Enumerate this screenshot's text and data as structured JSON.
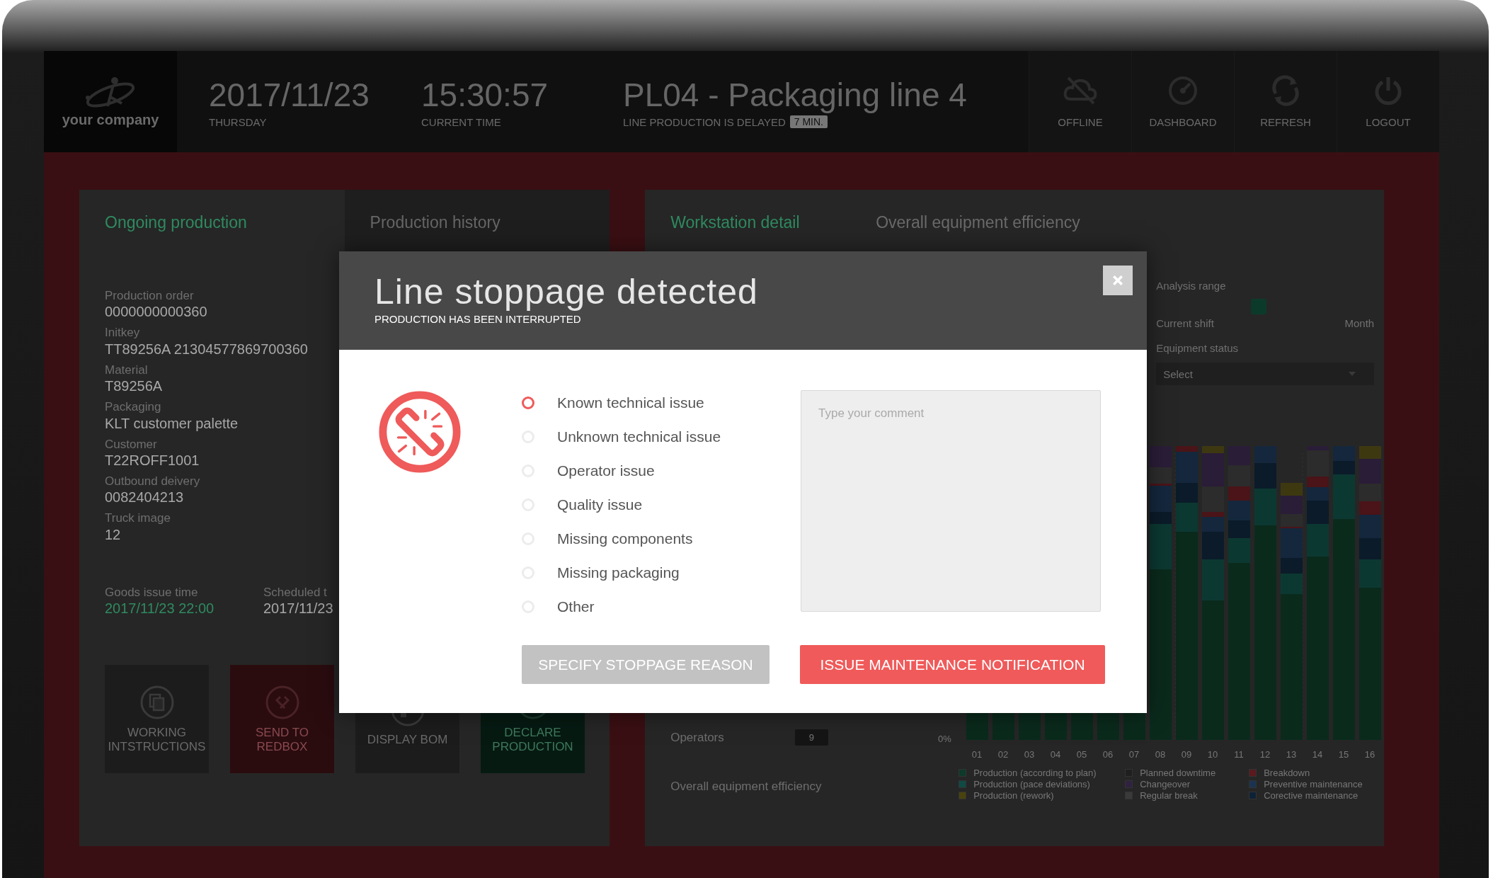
{
  "header": {
    "logo_text": "your company",
    "date": "2017/11/23",
    "weekday": "THURSDAY",
    "time": "15:30:57",
    "time_label": "CURRENT TIME",
    "line_title": "PL04 - Packaging line 4",
    "line_status": "LINE PRODUCTION IS DELAYED",
    "delay_badge": "7 MIN.",
    "actions": [
      {
        "label": "OFFLINE",
        "kind": "offline"
      },
      {
        "label": "DASHBOARD",
        "kind": "dashboard"
      },
      {
        "label": "REFRESH",
        "kind": "refresh"
      },
      {
        "label": "LOGOUT",
        "kind": "logout"
      }
    ]
  },
  "left_panel": {
    "tabs": [
      {
        "label": "Ongoing production",
        "selected": true
      },
      {
        "label": "Production history",
        "selected": false
      }
    ],
    "fields": [
      {
        "label": "Production order",
        "value": "0000000000360"
      },
      {
        "label": "Initkey",
        "value": "TT89256A 21304577869700360"
      },
      {
        "label": "Material",
        "value": "T89256A"
      },
      {
        "label": "Packaging",
        "value": "KLT customer palette"
      },
      {
        "label": "Customer",
        "value": "T22ROFF1001"
      },
      {
        "label": "Outbound deivery",
        "value": "0082404213"
      },
      {
        "label": "Truck image",
        "value": "12"
      }
    ],
    "schedule": [
      {
        "label": "Goods issue time",
        "value": "2017/11/23 22:00",
        "emphasized": true
      },
      {
        "label": "Scheduled t",
        "value": "2017/11/23",
        "emphasized": false
      }
    ],
    "tiles": [
      {
        "label": "WORKING INTSTRUCTIONS",
        "kind": "documents"
      },
      {
        "label": "SEND TO REDBOX",
        "kind": "redbox"
      },
      {
        "label": "DISPLAY BOM",
        "kind": "bom"
      },
      {
        "label": "DECLARE PRODUCTION",
        "kind": "declare"
      }
    ]
  },
  "right_panel": {
    "tabs": [
      {
        "label": "Workstation detail",
        "selected": true
      },
      {
        "label": "Overall equipment efficiency",
        "selected": false
      }
    ],
    "analysis_range": {
      "label": "Analysis range",
      "level": 0.47,
      "min_label": "Current shift",
      "max_label": "Month"
    },
    "equipment_status": {
      "label": "Equipment status",
      "placeholder": "Select"
    },
    "operators": {
      "label": "Operators",
      "value": "9"
    },
    "oee_label": "Overall equipment efficiency",
    "chart": {
      "y_tick": "0%",
      "x_labels": [
        "01",
        "02",
        "03",
        "04",
        "05",
        "06",
        "07",
        "08",
        "09",
        "10",
        "11",
        "12",
        "13",
        "14",
        "15",
        "16"
      ],
      "legend": [
        {
          "label": "Production (according to plan)",
          "color": "#0d3a2a"
        },
        {
          "label": "Planned downtime",
          "color": "#1f1f1f"
        },
        {
          "label": "Breakdown",
          "color": "#5a1a1e"
        },
        {
          "label": "Production (pace deviations)",
          "color": "#0f4a44"
        },
        {
          "label": "Changeover",
          "color": "#2e2240"
        },
        {
          "label": "Preventive maintenance",
          "color": "#1a3350"
        },
        {
          "label": "Production (rework)",
          "color": "#4a420e"
        },
        {
          "label": "Regular break",
          "color": "#3a3a3a"
        },
        {
          "label": "Corective maintenance",
          "color": "#0e2236"
        }
      ]
    }
  },
  "modal": {
    "title": "Line stoppage detected",
    "subtitle": "PRODUCTION HAS BEEN INTERRUPTED",
    "reasons": [
      {
        "label": "Known technical issue",
        "selected": true
      },
      {
        "label": "Unknown technical issue",
        "selected": false
      },
      {
        "label": "Operator issue",
        "selected": false
      },
      {
        "label": "Quality issue",
        "selected": false
      },
      {
        "label": "Missing components",
        "selected": false
      },
      {
        "label": "Missing packaging",
        "selected": false
      },
      {
        "label": "Other",
        "selected": false
      }
    ],
    "comment": {
      "placeholder": "Type your comment"
    },
    "buttons": [
      {
        "label": "SPECIFY STOPPAGE REASON",
        "kind": "secondary"
      },
      {
        "label": "ISSUE MAINTENANCE NOTIFICATION",
        "kind": "primary"
      }
    ]
  }
}
